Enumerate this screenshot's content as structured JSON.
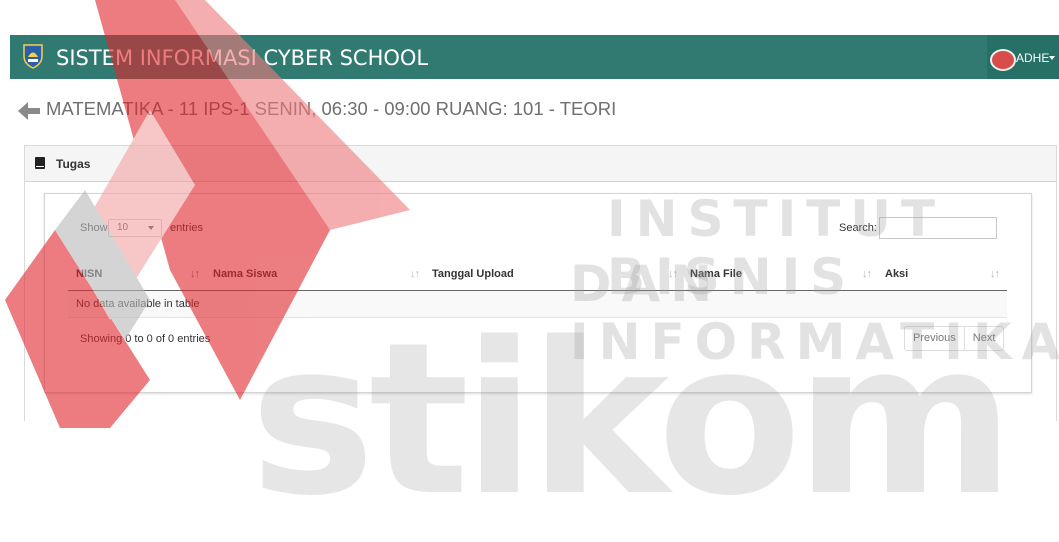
{
  "navbar": {
    "title": "SISTEM INFORMASI CYBER SCHOOL",
    "user": "ADHE"
  },
  "page": {
    "title": "MATEMATIKA - 11 IPS-1 SENIN, 06:30 - 09:00 RUANG: 101 - TEORI"
  },
  "panel": {
    "label": "Tugas"
  },
  "table": {
    "show_label": "Show",
    "page_length": "10",
    "entries_label": "entries",
    "search_label": "Search:",
    "columns": [
      "NISN",
      "Nama Siswa",
      "Tanggal Upload",
      "Nama File",
      "Aksi"
    ],
    "empty_text": "No data available in table",
    "info": "Showing 0 to 0 of 0 entries",
    "prev_label": "Previous",
    "next_label": "Next"
  },
  "watermark": {
    "line1": "INSTITUT BISNIS",
    "line2": "DAN INFORMATIKA",
    "line3": "stikom"
  },
  "colors": {
    "navbar": "#317a72",
    "navbar_dark": "#267066",
    "watermark_red": "#e0262b"
  },
  "icons": {
    "back": "arrow-left-icon",
    "panel": "book-icon",
    "sort": "sort-icon",
    "caret": "chevron-down-icon"
  }
}
